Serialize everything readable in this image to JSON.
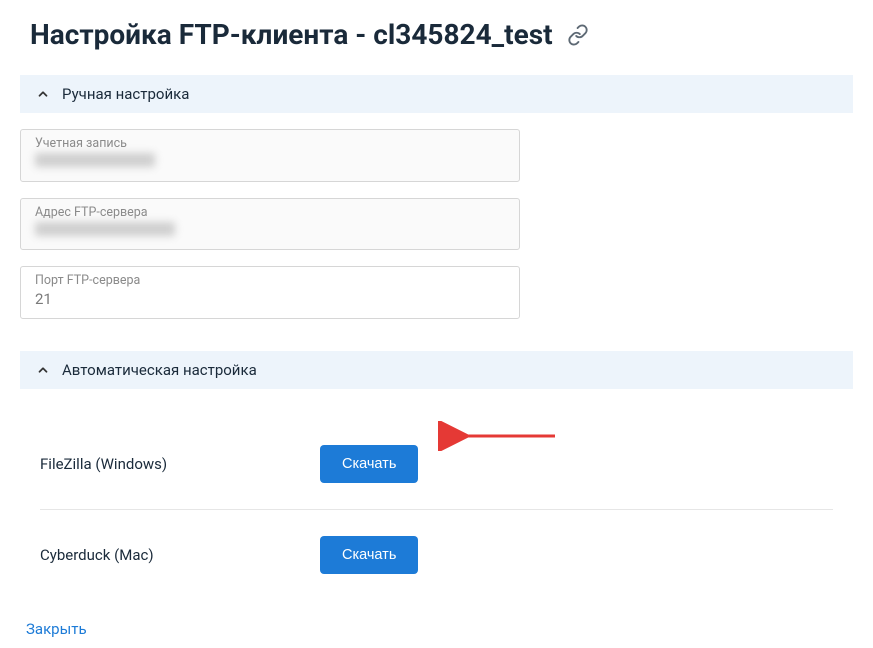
{
  "page_title": "Настройка FTP-клиента - cl345824_test",
  "sections": {
    "manual": {
      "label": "Ручная настройка"
    },
    "auto": {
      "label": "Автоматическая настройка"
    }
  },
  "fields": {
    "account": {
      "label": "Учетная запись",
      "value": ""
    },
    "server": {
      "label": "Адрес FTP-сервера",
      "value": ""
    },
    "port": {
      "label": "Порт FTP-сервера",
      "value": "21"
    }
  },
  "auto_rows": [
    {
      "name": "FileZilla (Windows)",
      "button": "Скачать"
    },
    {
      "name": "Cyberduck (Mac)",
      "button": "Скачать"
    }
  ],
  "close_label": "Закрыть",
  "annotation_arrow_color": "#e53935"
}
